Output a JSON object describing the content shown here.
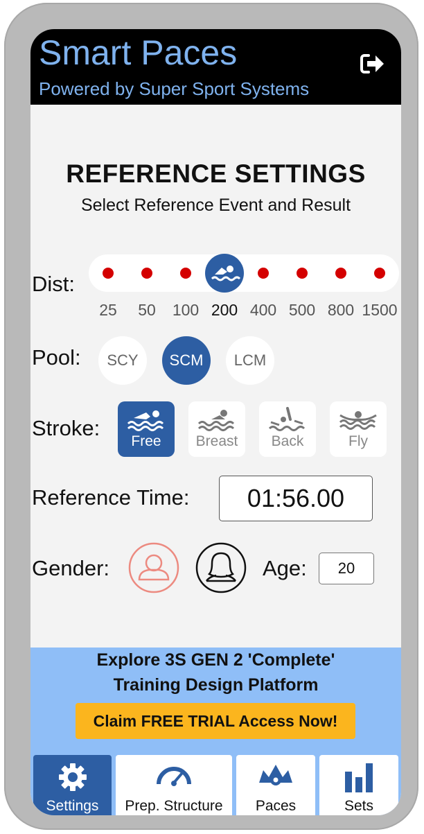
{
  "header": {
    "title": "Smart Paces",
    "subtitle": "Powered by Super Sport Systems",
    "logout_icon": "sign-out-icon"
  },
  "page": {
    "title": "REFERENCE SETTINGS",
    "subtitle": "Select Reference Event and Result"
  },
  "distance": {
    "label": "Dist:",
    "options": [
      "25",
      "50",
      "100",
      "200",
      "400",
      "500",
      "800",
      "1500"
    ],
    "selected": "200"
  },
  "pool": {
    "label": "Pool:",
    "options": [
      "SCY",
      "SCM",
      "LCM"
    ],
    "selected": "SCM"
  },
  "stroke": {
    "label": "Stroke:",
    "options": [
      "Free",
      "Breast",
      "Back",
      "Fly"
    ],
    "selected": "Free"
  },
  "reference_time": {
    "label": "Reference Time:",
    "value": "01:56.00"
  },
  "gender": {
    "label": "Gender:",
    "options": [
      "male-icon",
      "female-icon"
    ]
  },
  "age": {
    "label": "Age:",
    "value": "20"
  },
  "promo": {
    "line1": "Explore 3S GEN 2 'Complete'",
    "line2": "Training Design Platform",
    "cta": "Claim FREE TRIAL Access Now!"
  },
  "tabs": [
    {
      "label": "Settings",
      "icon": "gear-icon"
    },
    {
      "label": "Prep. Structure",
      "icon": "gauge-icon"
    },
    {
      "label": "Paces",
      "icon": "cogs-icon"
    },
    {
      "label": "Sets",
      "icon": "bar-chart-icon"
    }
  ],
  "selected_tab": "Settings",
  "colors": {
    "accent": "#2d5ea3",
    "header_text": "#7fb2ee",
    "promo_bg": "#8fbef7",
    "cta_bg": "#fbb51e",
    "dot": "#d40000"
  }
}
